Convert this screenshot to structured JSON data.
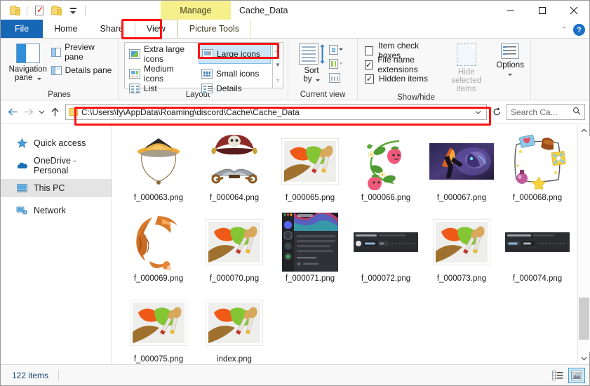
{
  "titlebar": {
    "quick_access": [
      {
        "name": "folder-icon",
        "label": "Cache_Data folder"
      },
      {
        "name": "properties-icon",
        "label": "Properties"
      },
      {
        "name": "new-folder-icon",
        "label": "New folder"
      },
      {
        "name": "customize-qat-icon",
        "label": "Customize Quick Access Toolbar"
      }
    ],
    "contextual_tab": "Manage",
    "title": "Cache_Data",
    "minimize": "—",
    "maximize": "☐",
    "close": "✕"
  },
  "tabs": [
    {
      "id": "file",
      "label": "File",
      "active": false
    },
    {
      "id": "home",
      "label": "Home",
      "active": false
    },
    {
      "id": "share",
      "label": "Share",
      "active": false
    },
    {
      "id": "view",
      "label": "View",
      "active": true,
      "highlighted": true
    },
    {
      "id": "picture-tools",
      "label": "Picture Tools",
      "active": false
    }
  ],
  "tabstrip_right": {
    "collapse_ribbon": "⌃",
    "help": "?"
  },
  "ribbon": {
    "groups": [
      {
        "id": "panes",
        "label": "Panes",
        "big_button": {
          "label_line1": "Navigation",
          "label_line2": "pane",
          "has_dropdown": true
        },
        "items": [
          {
            "label": "Preview pane"
          },
          {
            "label": "Details pane"
          }
        ]
      },
      {
        "id": "layout",
        "label": "Layout",
        "items": [
          {
            "label": "Extra large icons",
            "selected": false
          },
          {
            "label": "Large icons",
            "selected": true,
            "highlighted": true
          },
          {
            "label": "Medium icons",
            "selected": false
          },
          {
            "label": "Small icons",
            "selected": false
          },
          {
            "label": "List",
            "selected": false
          },
          {
            "label": "Details",
            "selected": false
          }
        ]
      },
      {
        "id": "current-view",
        "label": "Current view",
        "big_button": {
          "label_line1": "Sort",
          "label_line2": "by",
          "has_dropdown": true
        },
        "items": [
          {
            "label": "Group by",
            "enabled": true
          },
          {
            "label": "Add columns",
            "enabled": false
          },
          {
            "label": "Size all columns to fit",
            "enabled": true
          }
        ]
      },
      {
        "id": "show-hide",
        "label": "Show/hide",
        "checkboxes": [
          {
            "label": "Item check boxes",
            "checked": false
          },
          {
            "label": "File name extensions",
            "checked": true
          },
          {
            "label": "Hidden items",
            "checked": true
          }
        ],
        "big_buttons": [
          {
            "label_line1": "Hide selected",
            "label_line2": "items",
            "enabled": false,
            "has_dropdown": false
          },
          {
            "label_line1": "Options",
            "label_line2": "",
            "enabled": true,
            "has_dropdown": true
          }
        ]
      }
    ]
  },
  "addressbar": {
    "back": "←",
    "forward": "→",
    "recent": "⌄",
    "up": "↑",
    "path": "C:\\Users\\fy\\AppData\\Roaming\\discord\\Cache\\Cache_Data",
    "path_dropdown": "⌄",
    "refresh": "↻",
    "search_placeholder": "Search Ca...",
    "search_icon": "⚲",
    "highlighted": true
  },
  "sidebar": {
    "items": [
      {
        "id": "quick-access",
        "label": "Quick access",
        "icon": "star-icon",
        "selected": false
      },
      {
        "id": "onedrive",
        "label": "OneDrive - Personal",
        "icon": "cloud-icon",
        "selected": false
      },
      {
        "id": "this-pc",
        "label": "This PC",
        "icon": "monitor-icon",
        "selected": true
      },
      {
        "id": "network",
        "label": "Network",
        "icon": "network-icon",
        "selected": false
      }
    ]
  },
  "files": [
    {
      "name": "f_000063.png",
      "thumb": "hat"
    },
    {
      "name": "f_000064.png",
      "thumb": "pirate"
    },
    {
      "name": "f_000065.png",
      "thumb": "paint"
    },
    {
      "name": "f_000066.png",
      "thumb": "strawberry"
    },
    {
      "name": "f_000067.png",
      "thumb": "game"
    },
    {
      "name": "f_000068.png",
      "thumb": "frame"
    },
    {
      "name": "f_000069.png",
      "thumb": "fox"
    },
    {
      "name": "f_000070.png",
      "thumb": "paint"
    },
    {
      "name": "f_000071.png",
      "thumb": "discord-tall"
    },
    {
      "name": "f_000072.png",
      "thumb": "discord-bar"
    },
    {
      "name": "f_000073.png",
      "thumb": "paint"
    },
    {
      "name": "f_000074.png",
      "thumb": "discord-bar"
    },
    {
      "name": "f_000075.png",
      "thumb": "paint"
    },
    {
      "name": "index.png",
      "thumb": "paint"
    }
  ],
  "statusbar": {
    "item_count": "122 items",
    "view_details_icon": "details-view-icon",
    "view_thumbnails_icon": "thumbnail-view-icon",
    "active_view": "thumbnails"
  },
  "colors": {
    "accent": "#1667b5",
    "highlight_red": "#fc1414",
    "contextual_yellow": "#f5f08c",
    "selection_blue": "#cde6f7"
  }
}
